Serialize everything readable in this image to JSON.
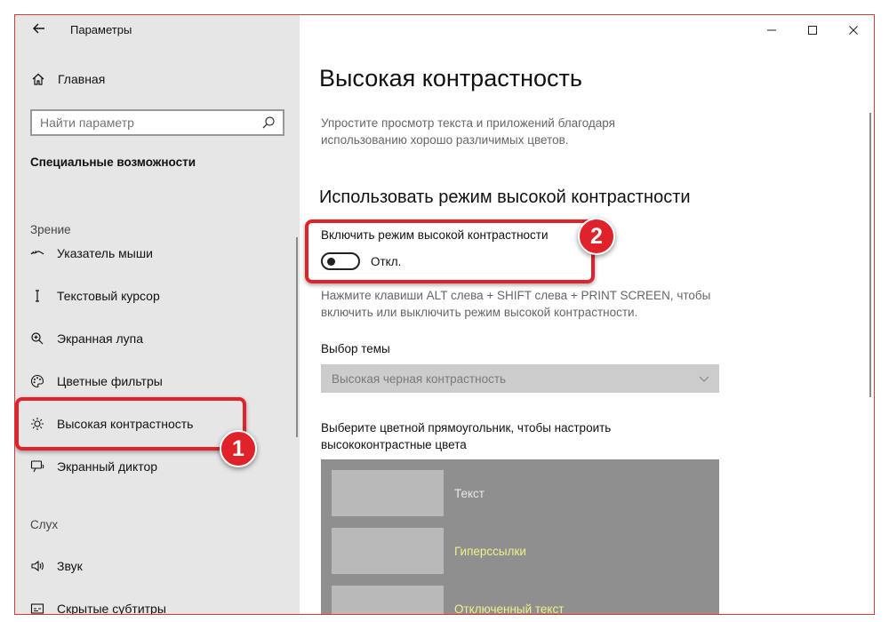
{
  "window": {
    "title": "Параметры",
    "controls": {
      "minimize": "—",
      "maximize": "☐",
      "close": "✕"
    }
  },
  "sidebar": {
    "home_label": "Главная",
    "search_placeholder": "Найти параметр",
    "section_title": "Специальные возможности",
    "groups": [
      {
        "label": "Зрение"
      },
      {
        "label": "Слух"
      }
    ],
    "items": [
      {
        "label": "Указатель мыши",
        "icon": "mouse-pointer-icon"
      },
      {
        "label": "Текстовый курсор",
        "icon": "text-cursor-icon"
      },
      {
        "label": "Экранная лупа",
        "icon": "magnifier-icon"
      },
      {
        "label": "Цветные фильтры",
        "icon": "color-filter-icon"
      },
      {
        "label": "Высокая контрастность",
        "icon": "brightness-icon",
        "selected": true
      },
      {
        "label": "Экранный диктор",
        "icon": "narrator-icon"
      },
      {
        "label": "Звук",
        "icon": "speaker-icon"
      },
      {
        "label": "Скрытые субтитры",
        "icon": "captions-icon"
      }
    ]
  },
  "main": {
    "title": "Высокая контрастность",
    "description": "Упростите просмотр текста и приложений благодаря использованию хорошо различимых цветов.",
    "subtitle": "Использовать режим высокой контрастности",
    "toggle_label": "Включить режим высокой контрастности",
    "toggle_state": "Откл.",
    "toggle_on": false,
    "hint": "Нажмите клавиши ALT слева + SHIFT слева + PRINT SCREEN, чтобы включить или выключить режим высокой контрастности.",
    "theme_label": "Выбор темы",
    "theme_value": "Высокая черная контрастность",
    "colors_label": "Выберите цветной прямоугольник, чтобы настроить высококонтрастные цвета",
    "swatches": [
      {
        "label": "Текст"
      },
      {
        "label": "Гиперссылки"
      },
      {
        "label": "Отключенный текст"
      }
    ]
  },
  "annotations": [
    {
      "number": "1"
    },
    {
      "number": "2"
    }
  ],
  "colors": {
    "accent_red": "#e0222a",
    "sidebar_bg": "#e6e6e6",
    "hyperlink": "#f0f08a"
  }
}
